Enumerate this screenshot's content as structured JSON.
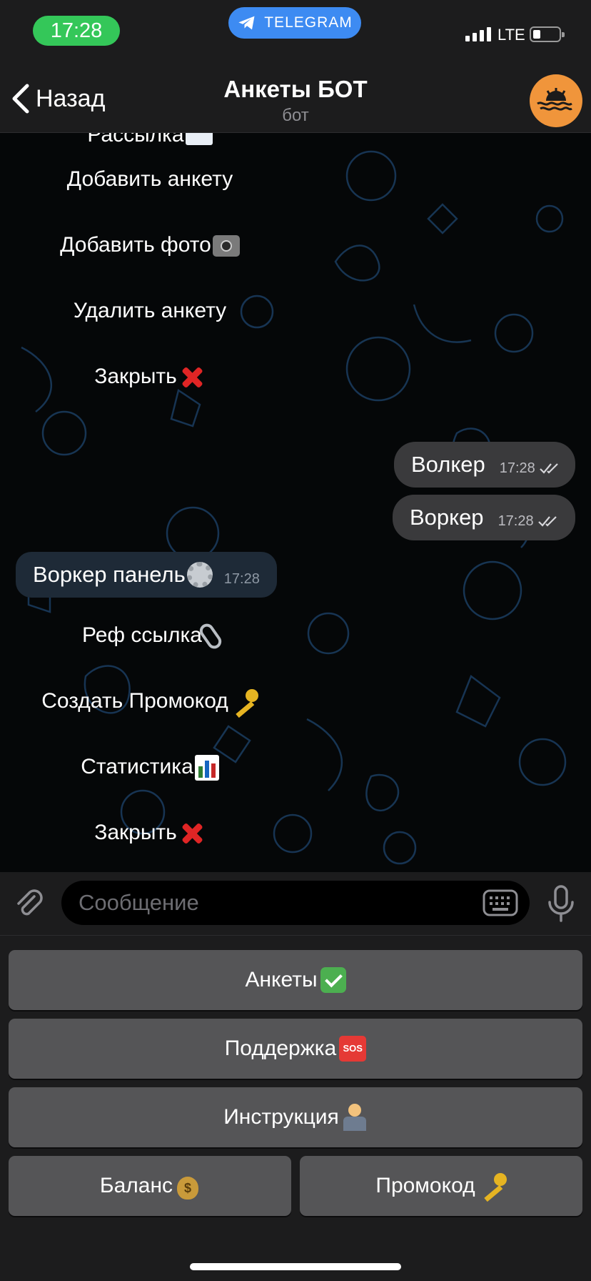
{
  "status_bar": {
    "time": "17:28",
    "app_pill": "TELEGRAM",
    "network": "LTE"
  },
  "nav": {
    "back_label": "Назад",
    "title": "Анкеты БОТ",
    "subtitle": "бот"
  },
  "chat": {
    "menu1": [
      {
        "label": "Рассылка",
        "emoji": "envelope-icon"
      },
      {
        "label": "Добавить анкету",
        "emoji": ""
      },
      {
        "label": "Добавить фото",
        "emoji": "camera-flash-icon"
      },
      {
        "label": "Удалить анкету",
        "emoji": ""
      },
      {
        "label": "Закрыть",
        "emoji": "cross-mark-icon"
      }
    ],
    "outgoing": [
      {
        "text": "Волкер",
        "time": "17:28"
      },
      {
        "text": "Воркер",
        "time": "17:28"
      }
    ],
    "incoming": {
      "text": "Воркер панель",
      "emoji": "gear-icon",
      "time": "17:28"
    },
    "menu2": [
      {
        "label": "Реф ссылка",
        "emoji": "paperclip-icon"
      },
      {
        "label": "Создать Промокод",
        "emoji": "key-icon"
      },
      {
        "label": "Статистика",
        "emoji": "bar-chart-icon"
      },
      {
        "label": "Закрыть",
        "emoji": "cross-mark-icon"
      }
    ]
  },
  "input": {
    "placeholder": "Сообщение"
  },
  "keyboard": {
    "ankety": "Анкеты",
    "support": "Поддержка",
    "instruction": "Инструкция",
    "balance": "Баланс",
    "promo": "Промокод"
  },
  "colors": {
    "status_pill": "#34c759",
    "telegram_pill": "#3d8bf2",
    "avatar": "#f0953b",
    "bubble_out": "#3a3a3c",
    "bubble_in": "#1e2a37"
  }
}
